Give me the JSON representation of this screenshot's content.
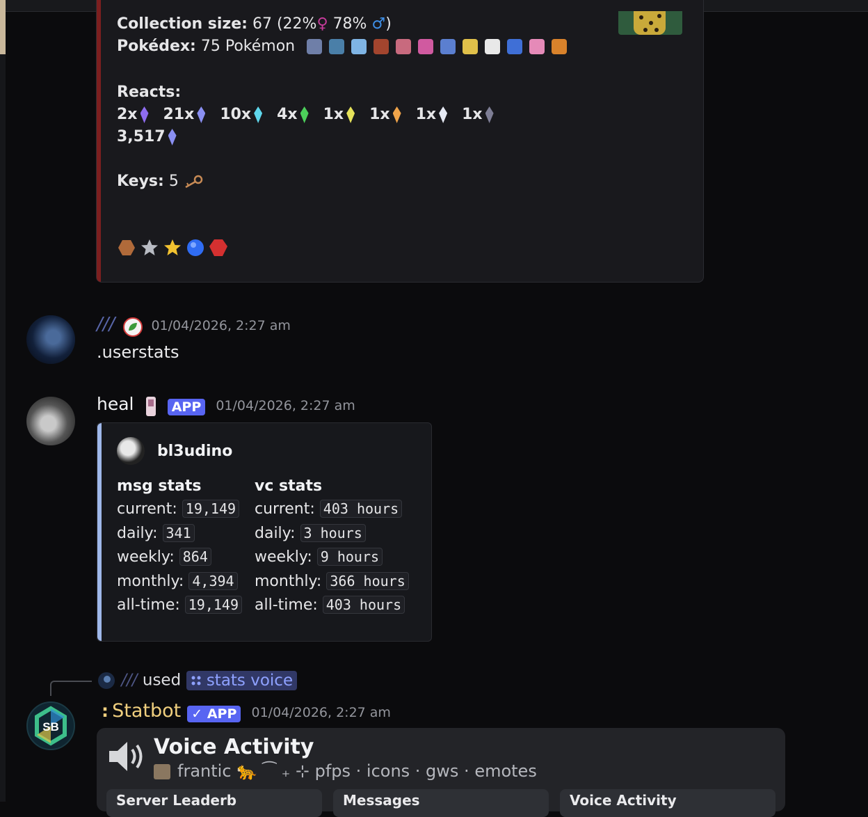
{
  "embed_top": {
    "collection_label": "Collection size:",
    "collection_value": "67 (22%",
    "female_symbol": "♀",
    "male_pct": "78%",
    "male_symbol": "♂",
    "close_paren": ")",
    "pokedex_label": "Pokédex:",
    "pokedex_value": "75 Pokémon",
    "reacts_label": "Reacts:",
    "reacts": [
      {
        "count": "2x",
        "color": "#8e6cf0"
      },
      {
        "count": "21x",
        "color": "#8a8ff2"
      },
      {
        "count": "10x",
        "color": "#5fd7ec"
      },
      {
        "count": "4x",
        "color": "#4ccf5a"
      },
      {
        "count": "1x",
        "color": "#e6e25a"
      },
      {
        "count": "1x",
        "color": "#f0a44a"
      },
      {
        "count": "1x",
        "color": "#e6eaf4"
      },
      {
        "count": "1x",
        "color": "#7e7e95"
      }
    ],
    "total_reacts": "3,517",
    "keys_label": "Keys:",
    "keys_value": "5",
    "key_icon": "key-icon",
    "badge_colors": [
      "#b06a3a",
      "#b9bcc4",
      "#f2c230",
      "#2f6cf2",
      "#d43030"
    ]
  },
  "msg1": {
    "name_mark": "///",
    "timestamp": "01/04/2026, 2:27 am",
    "text": ".userstats"
  },
  "msg2": {
    "username": "heal",
    "tag": "APP",
    "timestamp": "01/04/2026, 2:27 am",
    "embed": {
      "author": "bl3udino",
      "msg_title": "msg stats",
      "vc_title": "vc stats",
      "msg_rows": [
        {
          "label": "current:",
          "value": "19,149"
        },
        {
          "label": "daily:",
          "value": "341"
        },
        {
          "label": "weekly:",
          "value": "864"
        },
        {
          "label": "monthly:",
          "value": "4,394"
        },
        {
          "label": "all-time:",
          "value": "19,149"
        }
      ],
      "vc_rows": [
        {
          "label": "current:",
          "value": "403 hours"
        },
        {
          "label": "daily:",
          "value": "3 hours"
        },
        {
          "label": "weekly:",
          "value": "9 hours"
        },
        {
          "label": "monthly:",
          "value": "366 hours"
        },
        {
          "label": "all-time:",
          "value": "403 hours"
        }
      ]
    }
  },
  "msg3": {
    "reply_mark": "///",
    "used_text": "used",
    "command": "stats voice",
    "prefix": ":",
    "username": "Statbot",
    "tag": "✓ APP",
    "timestamp": "01/04/2026, 2:27 am",
    "avatar_text": "SB",
    "embed": {
      "title": "Voice Activity",
      "subtitle": "frantic 🐆 ⁀ ₊ ⊹ pfps · icons · gws · emotes",
      "tabs": [
        "Server Leaderb",
        "Messages",
        "Voice Activity"
      ]
    }
  },
  "colors": {
    "accent_blurple": "#5865f2",
    "embed_bar_red": "#7c1f1f",
    "embed_bar_blue": "#9fb8ea",
    "statbot_name": "#f0cf7e"
  }
}
